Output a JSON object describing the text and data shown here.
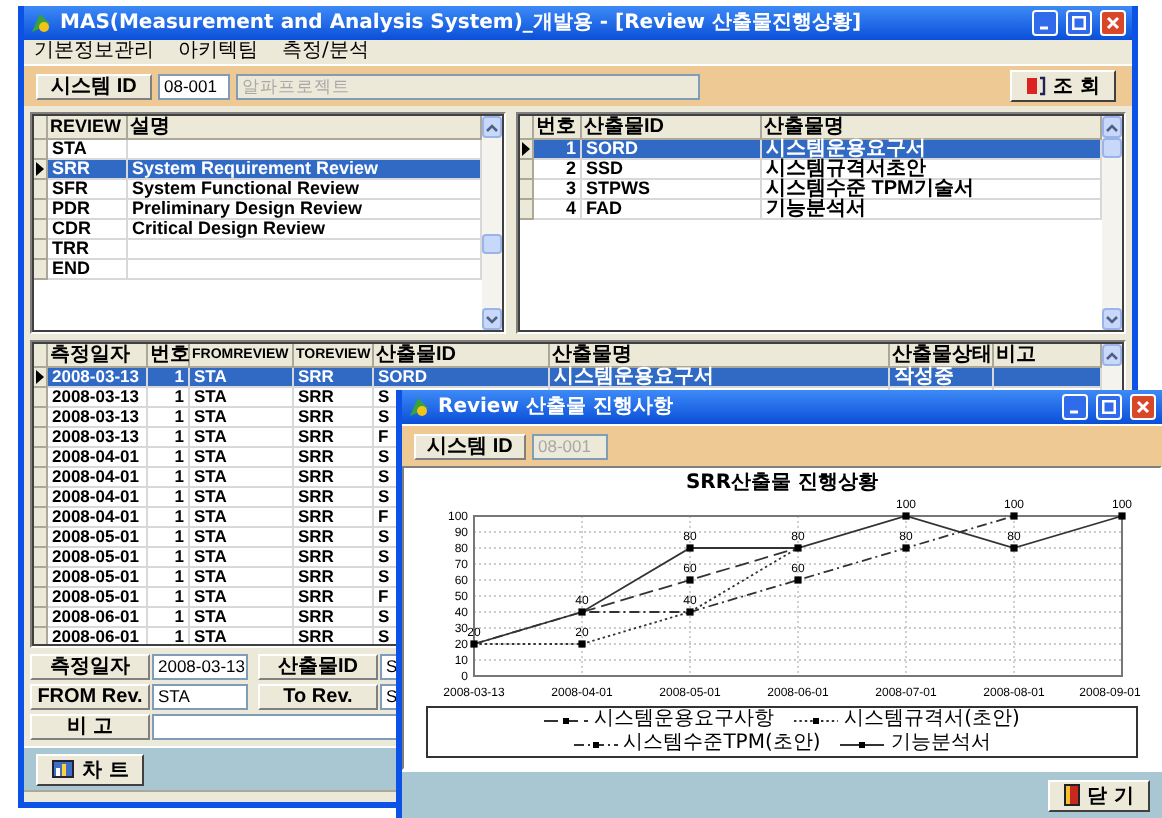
{
  "main_window": {
    "title": "MAS(Measurement and Analysis System)_개발용 - [Review 산출물진행상황]",
    "menu": [
      "기본정보관리",
      "아키텍팀",
      "측정/분석"
    ],
    "toolbar": {
      "label": "시스템 ID",
      "system_id": {
        "value": "08-001",
        "disabled": false
      },
      "project": {
        "value": "알파프로젝트",
        "disabled": true
      },
      "search_button": "조 회"
    },
    "review_grid": {
      "columns": [
        "REVIEW",
        "설명"
      ],
      "rows": [
        {
          "cells": [
            "STA"
          ],
          "selected": false
        },
        {
          "cells": [
            "SRR",
            "System Requirement Review"
          ],
          "selected": true
        },
        {
          "cells": [
            "SFR",
            "System Functional Review"
          ],
          "selected": false
        },
        {
          "cells": [
            "PDR",
            "Preliminary Design Review"
          ],
          "selected": false
        },
        {
          "cells": [
            "CDR",
            "Critical Design Review"
          ],
          "selected": false
        },
        {
          "cells": [
            "TRR"
          ],
          "selected": false
        },
        {
          "cells": [
            "END"
          ],
          "selected": false
        }
      ]
    },
    "deliverable_grid": {
      "columns": [
        "번호",
        "산출물ID",
        "산출물명"
      ],
      "rows": [
        {
          "cells": [
            "1",
            "SORD",
            "시스템운용요구서"
          ],
          "selected": true
        },
        {
          "cells": [
            "2",
            "SSD",
            "시스템규격서초안"
          ],
          "selected": false
        },
        {
          "cells": [
            "3",
            "STPWS",
            "시스템수준 TPM기술서"
          ],
          "selected": false
        },
        {
          "cells": [
            "4",
            "FAD",
            "기능분석서"
          ],
          "selected": false
        }
      ]
    },
    "measurement_grid": {
      "columns": [
        "측정일자",
        "번호",
        "FROMREVIEW",
        "TOREVIEW",
        "산출물ID",
        "산출물명",
        "산출물상태",
        "비고"
      ],
      "rows": [
        {
          "cells": [
            "2008-03-13",
            "1",
            "STA",
            "SRR",
            "SORD",
            "시스템운용요구서",
            "작성중"
          ],
          "selected": true
        },
        {
          "cells": [
            "2008-03-13",
            "1",
            "STA",
            "SRR",
            "S"
          ],
          "selected": false
        },
        {
          "cells": [
            "2008-03-13",
            "1",
            "STA",
            "SRR",
            "S"
          ],
          "selected": false
        },
        {
          "cells": [
            "2008-03-13",
            "1",
            "STA",
            "SRR",
            "F"
          ],
          "selected": false
        },
        {
          "cells": [
            "2008-04-01",
            "1",
            "STA",
            "SRR",
            "S"
          ],
          "selected": false
        },
        {
          "cells": [
            "2008-04-01",
            "1",
            "STA",
            "SRR",
            "S"
          ],
          "selected": false
        },
        {
          "cells": [
            "2008-04-01",
            "1",
            "STA",
            "SRR",
            "S"
          ],
          "selected": false
        },
        {
          "cells": [
            "2008-04-01",
            "1",
            "STA",
            "SRR",
            "F"
          ],
          "selected": false
        },
        {
          "cells": [
            "2008-05-01",
            "1",
            "STA",
            "SRR",
            "S"
          ],
          "selected": false
        },
        {
          "cells": [
            "2008-05-01",
            "1",
            "STA",
            "SRR",
            "S"
          ],
          "selected": false
        },
        {
          "cells": [
            "2008-05-01",
            "1",
            "STA",
            "SRR",
            "S"
          ],
          "selected": false
        },
        {
          "cells": [
            "2008-05-01",
            "1",
            "STA",
            "SRR",
            "F"
          ],
          "selected": false
        },
        {
          "cells": [
            "2008-06-01",
            "1",
            "STA",
            "SRR",
            "S"
          ],
          "selected": false
        },
        {
          "cells": [
            "2008-06-01",
            "1",
            "STA",
            "SRR",
            "S"
          ],
          "selected": false
        }
      ]
    },
    "form": {
      "fields": [
        {
          "label": "측정일자",
          "value": "2008-03-13"
        },
        {
          "label": "산출물ID",
          "value": "S"
        },
        {
          "label": "FROM Rev.",
          "value": "STA"
        },
        {
          "label": "To Rev.",
          "value": "S"
        },
        {
          "label": "비 고"
        }
      ]
    },
    "chart_button": "차 트"
  },
  "chart_dialog": {
    "title": "Review 산출물 진행사항",
    "label": "시스템 ID",
    "system_id": {
      "value": "08-001",
      "disabled": true
    },
    "chart_data": {
      "type": "line",
      "title": "SRR산출물 진행상황",
      "categories": [
        "2008-03-13",
        "2008-04-01",
        "2008-05-01",
        "2008-06-01",
        "2008-07-01",
        "2008-08-01",
        "2008-09-01"
      ],
      "ylim": [
        0,
        100
      ],
      "yticks": [
        0,
        10,
        20,
        30,
        40,
        50,
        60,
        70,
        80,
        90,
        100
      ],
      "grid": true,
      "legend": "bottom",
      "series": [
        {
          "name": "시스템운용요구사항",
          "line_style": "dashed",
          "marker": "square",
          "values": [
            null,
            40,
            60,
            80,
            null,
            null,
            null
          ],
          "value_labels": [
            null,
            "40",
            "60",
            "80",
            null,
            null,
            null
          ]
        },
        {
          "name": "시스템규격서(초안)",
          "line_style": "dotted",
          "marker": "square",
          "values": [
            20,
            20,
            40,
            80,
            null,
            null,
            null
          ],
          "value_labels": [
            "20",
            "20",
            "40",
            null,
            null,
            null,
            null
          ]
        },
        {
          "name": "시스템수준TPM(초안)",
          "line_style": "dashdot",
          "marker": "square",
          "values": [
            20,
            40,
            40,
            60,
            80,
            100,
            null
          ],
          "value_labels": [
            null,
            null,
            null,
            "60",
            "80",
            "100",
            null
          ]
        },
        {
          "name": "기능분석서",
          "line_style": "solid",
          "marker": "square",
          "values": [
            20,
            40,
            80,
            80,
            100,
            80,
            100
          ],
          "value_labels": [
            null,
            null,
            "80",
            null,
            "100",
            "80",
            "100"
          ]
        }
      ]
    },
    "close_button": "닫 기"
  }
}
